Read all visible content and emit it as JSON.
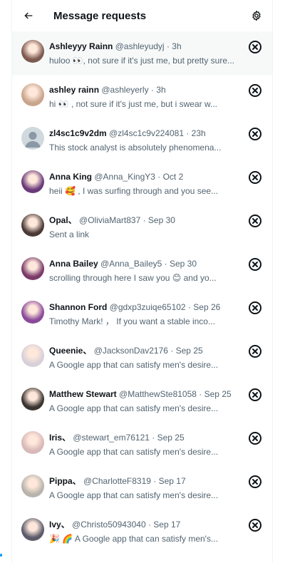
{
  "header": {
    "title": "Message requests",
    "back_icon": "arrow-left-icon",
    "settings_icon": "gear-icon"
  },
  "requests": [
    {
      "name": "Ashleyyy Rainn",
      "handle": "@ashleyudyj",
      "time": "· 3h",
      "preview": "huloo 👀, not sure if it's just me, but pretty sure...",
      "avatar_color": "#7d5a4f"
    },
    {
      "name": "ashley rainn",
      "handle": "@ashleyerly",
      "time": "· 3h",
      "preview": "hi 👀 , not sure if it's just me, but i swear w...",
      "avatar_color": "#c9a48c"
    },
    {
      "name": "zl4sc1c9v2dm",
      "handle": "@zl4sc1c9v224081",
      "time": "· 23h",
      "preview": "This stock analyst is absolutely phenomena...",
      "avatar_color": "#cfd9de"
    },
    {
      "name": "Anna King",
      "handle": "@Anna_KingY3",
      "time": "· Oct 2",
      "preview": "heii 🥰 , I was surfing through and you see...",
      "avatar_color": "#6a3a7a"
    },
    {
      "name": "Opal、",
      "handle": "@OliviaMart837",
      "time": "· Sep 30",
      "preview": "Sent a link",
      "avatar_color": "#4a3a36"
    },
    {
      "name": "Anna Bailey",
      "handle": "@Anna_Bailey5",
      "time": "· Sep 30",
      "preview": "scrolling through here I saw you 😊 and yo...",
      "avatar_color": "#7a3a6a"
    },
    {
      "name": "Shannon Ford",
      "handle": "@gdxp3zuiqe65102",
      "time": "· Sep 26",
      "preview": "Timothy Mark! ， If you want a stable inco...",
      "avatar_color": "#8a4a9a"
    },
    {
      "name": "Queenie、",
      "handle": "@JacksonDav2176",
      "time": "· Sep 25",
      "preview": "A Google app that can satisfy men's desire...",
      "avatar_color": "#d8d0d8"
    },
    {
      "name": "Matthew Stewart",
      "handle": "@MatthewSte81058",
      "time": "· Sep 25",
      "preview": "A Google app that can satisfy men's desire...",
      "avatar_color": "#3a3430"
    },
    {
      "name": "Iris、",
      "handle": "@stewart_em76121",
      "time": "· Sep 25",
      "preview": "A Google app that can satisfy men's desire...",
      "avatar_color": "#d8b8b8"
    },
    {
      "name": "Pippa、",
      "handle": "@CharlotteF8319",
      "time": "· Sep 17",
      "preview": "A Google app that can satisfy men's desire...",
      "avatar_color": "#b8b4ac"
    },
    {
      "name": "Ivy、",
      "handle": "@Christo50943040",
      "time": "· Sep 17",
      "preview": "🎉 🌈  A Google app that can satisfy men's...",
      "avatar_color": "#5a5a6a"
    }
  ],
  "dismiss_icon": "close-circle-icon"
}
